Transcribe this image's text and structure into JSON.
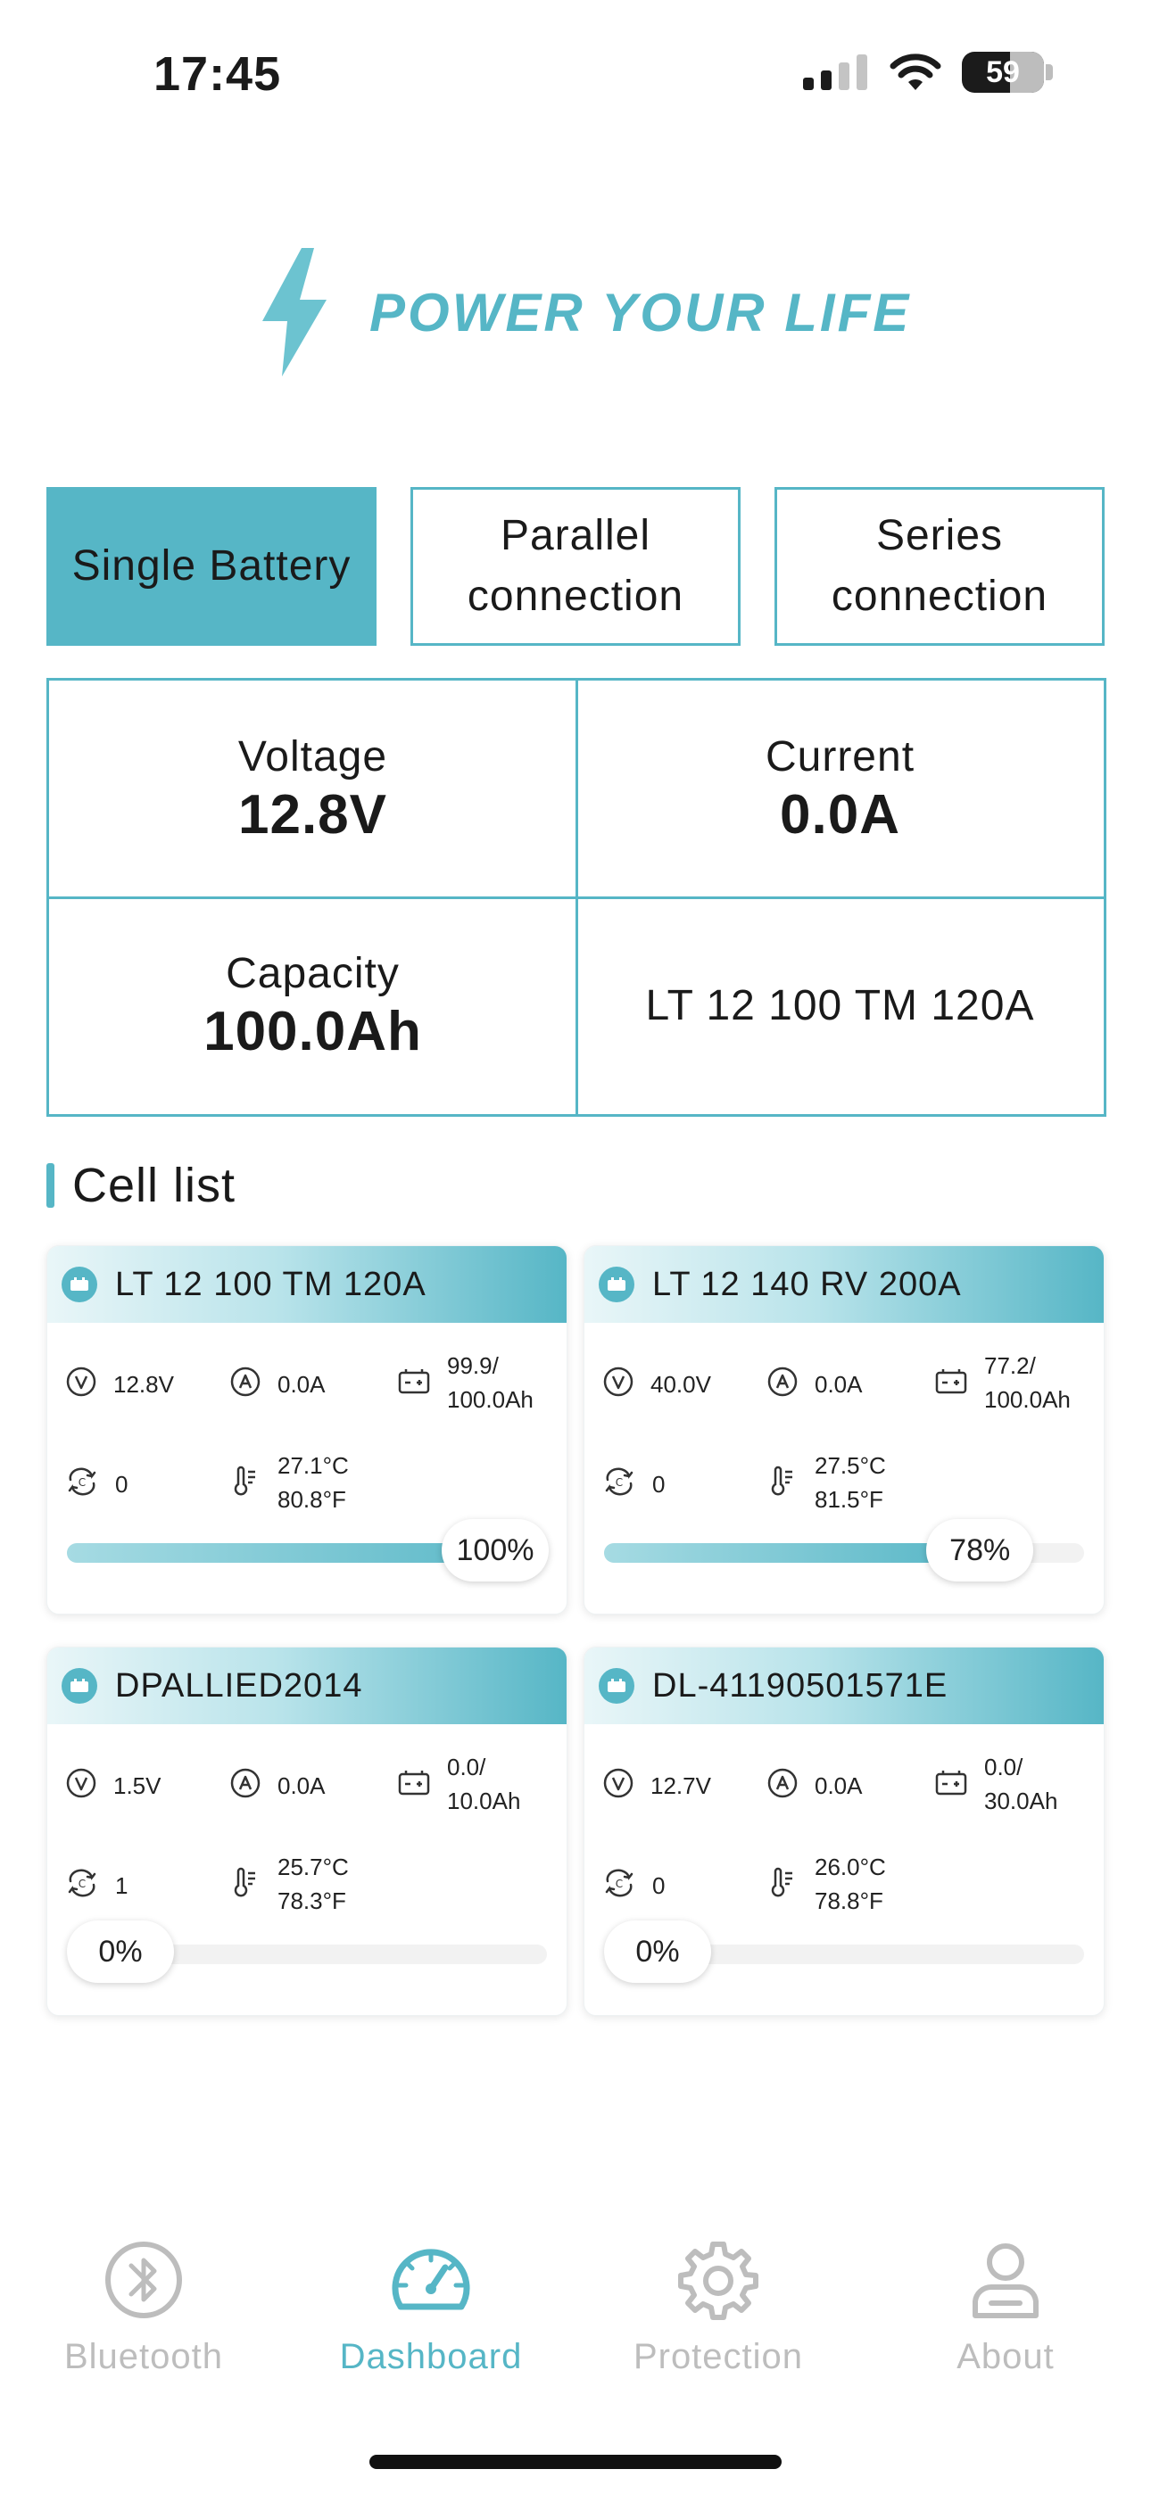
{
  "status_bar": {
    "time": "17:45",
    "battery_level": "59"
  },
  "brand": {
    "tagline": "POWER YOUR LIFE",
    "accent": "#56b6c6"
  },
  "mode_tabs": [
    {
      "label": "Single Battery",
      "active": true
    },
    {
      "label": "Parallel\nconnection",
      "active": false
    },
    {
      "label": "Series\nconnection",
      "active": false
    }
  ],
  "summary": {
    "voltage_label": "Voltage",
    "voltage_value": "12.8V",
    "current_label": "Current",
    "current_value": "0.0A",
    "capacity_label": "Capacity",
    "capacity_value": "100.0Ah",
    "model": "LT 12 100 TM 120A"
  },
  "cell_list": {
    "title": "Cell list",
    "cells": [
      {
        "name": "LT 12 100 TM 120A",
        "voltage": "12.8V",
        "current": "0.0A",
        "capacity": "99.9/\n100.0Ah",
        "cycles": "0",
        "temperature": "27.1°C\n80.8°F",
        "soc_label": "100%",
        "soc": 1.0
      },
      {
        "name": "LT 12 140 RV 200A",
        "voltage": "40.0V",
        "current": "0.0A",
        "capacity": "77.2/\n100.0Ah",
        "cycles": "0",
        "temperature": "27.5°C\n81.5°F",
        "soc_label": "78%",
        "soc": 0.78
      },
      {
        "name": "DPALLIED2014",
        "voltage": "1.5V",
        "current": "0.0A",
        "capacity": "0.0/\n10.0Ah",
        "cycles": "1",
        "temperature": "25.7°C\n78.3°F",
        "soc_label": "0%",
        "soc": 0.0
      },
      {
        "name": "DL-41190501571E",
        "voltage": "12.7V",
        "current": "0.0A",
        "capacity": "0.0/\n30.0Ah",
        "cycles": "0",
        "temperature": "26.0°C\n78.8°F",
        "soc_label": "0%",
        "soc": 0.0
      }
    ]
  },
  "nav": [
    {
      "label": "Bluetooth",
      "icon": "bluetooth-icon",
      "active": false
    },
    {
      "label": "Dashboard",
      "icon": "speedometer-icon",
      "active": true
    },
    {
      "label": "Protection",
      "icon": "gear-icon",
      "active": false
    },
    {
      "label": "About",
      "icon": "person-icon",
      "active": false
    }
  ]
}
